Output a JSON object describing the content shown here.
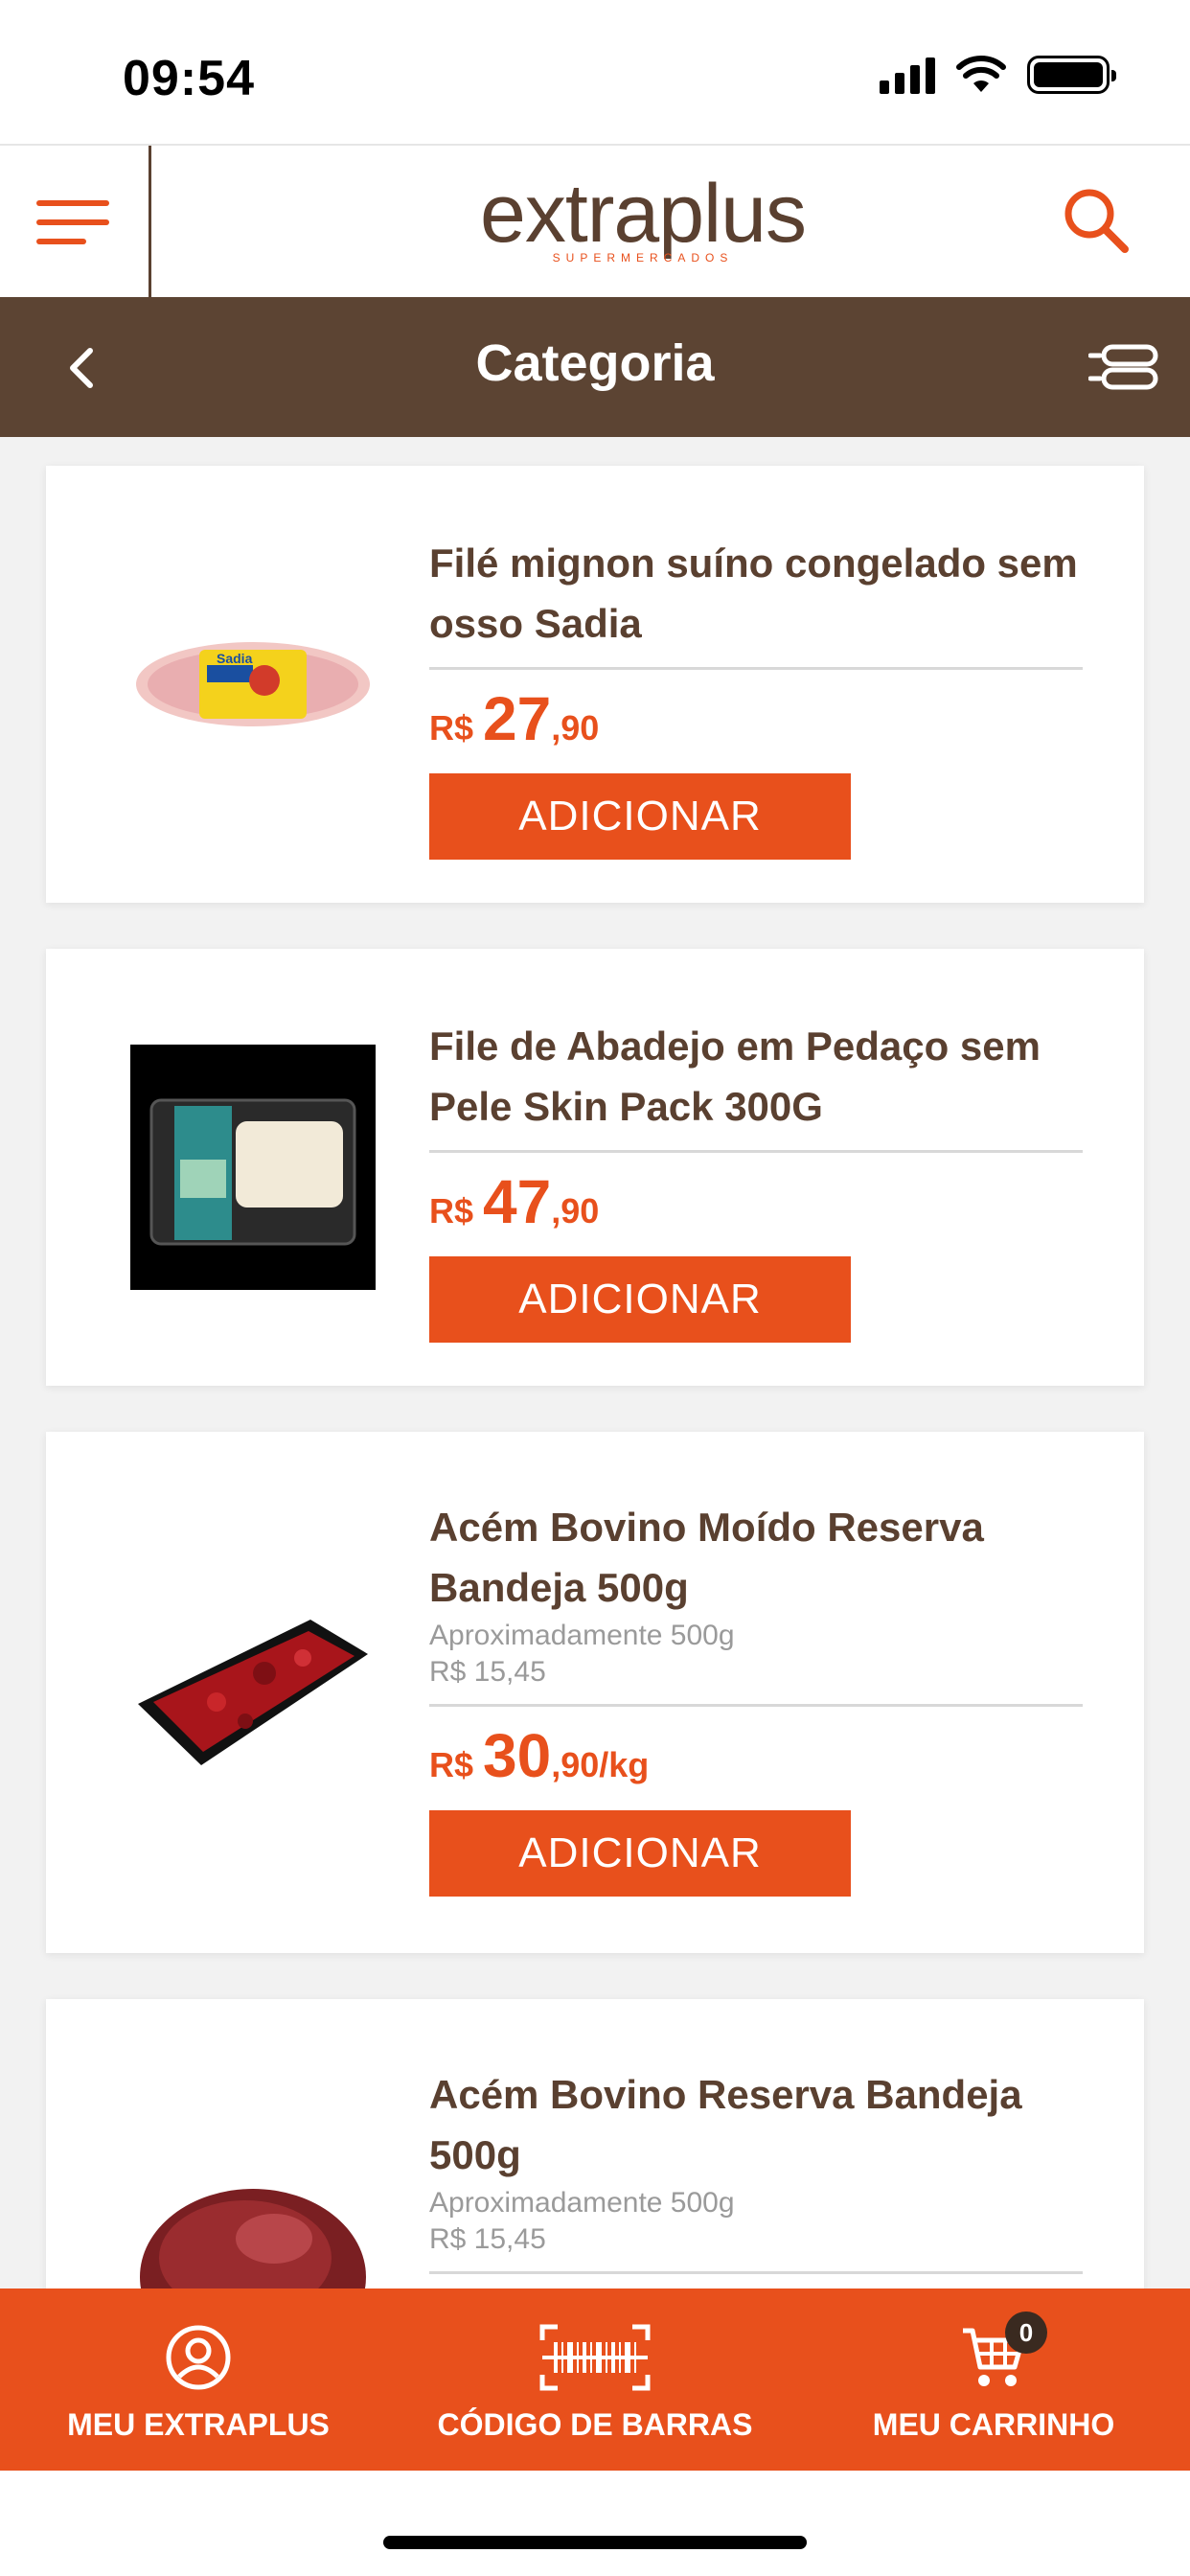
{
  "status_bar": {
    "time": "09:54"
  },
  "header": {
    "logo_text": "extraplus",
    "logo_subtitle": "SUPERMERCADOS"
  },
  "category_bar": {
    "title": "Categoria"
  },
  "products": [
    {
      "name": "Filé mignon suíno congelado sem osso Sadia",
      "subtitle": "",
      "unit_price": "",
      "currency": "R$",
      "price_int": "27",
      "price_dec": ",90",
      "button": "ADICIONAR"
    },
    {
      "name": "File de Abadejo em Pedaço sem Pele Skin Pack 300G",
      "subtitle": "",
      "unit_price": "",
      "currency": "R$",
      "price_int": "47",
      "price_dec": ",90",
      "button": "ADICIONAR"
    },
    {
      "name": "Acém Bovino Moído Reserva Bandeja 500g",
      "subtitle": "Aproximadamente 500g",
      "unit_price": "R$ 15,45",
      "currency": "R$",
      "price_int": "30",
      "price_dec": ",90/kg",
      "button": "ADICIONAR"
    },
    {
      "name": "Acém Bovino Reserva Bandeja 500g",
      "subtitle": "Aproximadamente 500g",
      "unit_price": "R$ 15,45"
    }
  ],
  "bottom_nav": {
    "account": "MEU EXTRAPLUS",
    "barcode": "CÓDIGO DE BARRAS",
    "cart": "MEU CARRINHO",
    "cart_count": "0"
  },
  "colors": {
    "accent": "#e8501c",
    "brown": "#5c4433",
    "text_brown": "#5a4030"
  }
}
